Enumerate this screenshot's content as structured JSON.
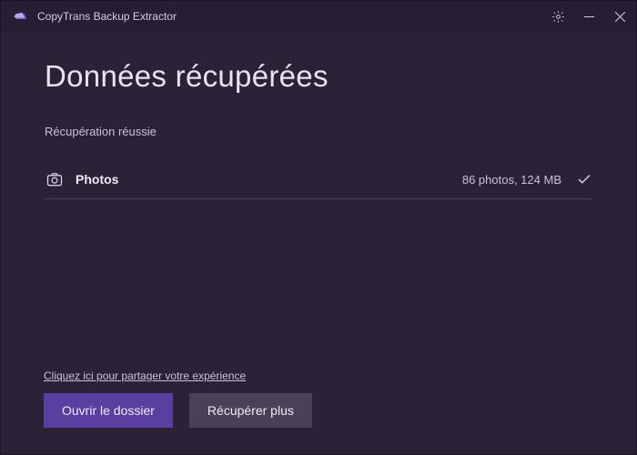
{
  "window": {
    "app_title": "CopyTrans Backup Extractor"
  },
  "header": {
    "page_title": "Données récupérées",
    "status": "Récupération réussie"
  },
  "items": [
    {
      "label": "Photos",
      "meta": "86 photos, 124 MB",
      "icon": "camera-icon"
    }
  ],
  "footer": {
    "feedback_link": "Cliquez ici pour partager votre expérience",
    "primary_button": "Ouvrir le dossier",
    "secondary_button": "Récupérer plus"
  }
}
